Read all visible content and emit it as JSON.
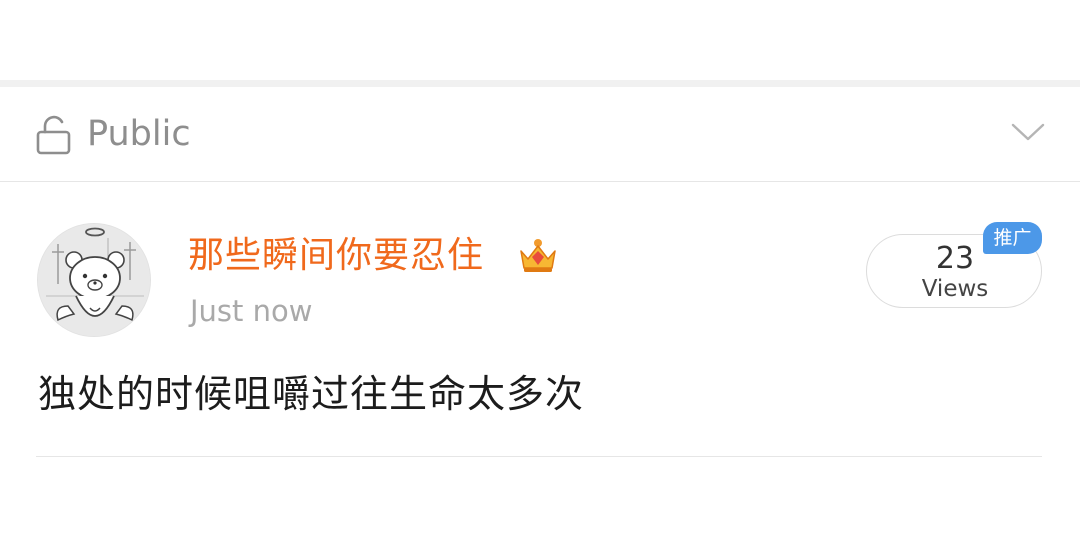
{
  "visibility": {
    "label": "Public",
    "icon": "lock-open-icon",
    "dropdown_icon": "chevron-down-icon"
  },
  "post": {
    "username": "那些瞬间你要忍住",
    "badge_icon": "crown-icon",
    "timestamp": "Just now",
    "views": {
      "count": "23",
      "label": "Views"
    },
    "promo_badge": "推广",
    "text": "独处的时候咀嚼过往生命太多次"
  },
  "colors": {
    "username": "#f0691c",
    "promo_badge": "#4c98e8",
    "meta_text": "#a9a9a9"
  }
}
